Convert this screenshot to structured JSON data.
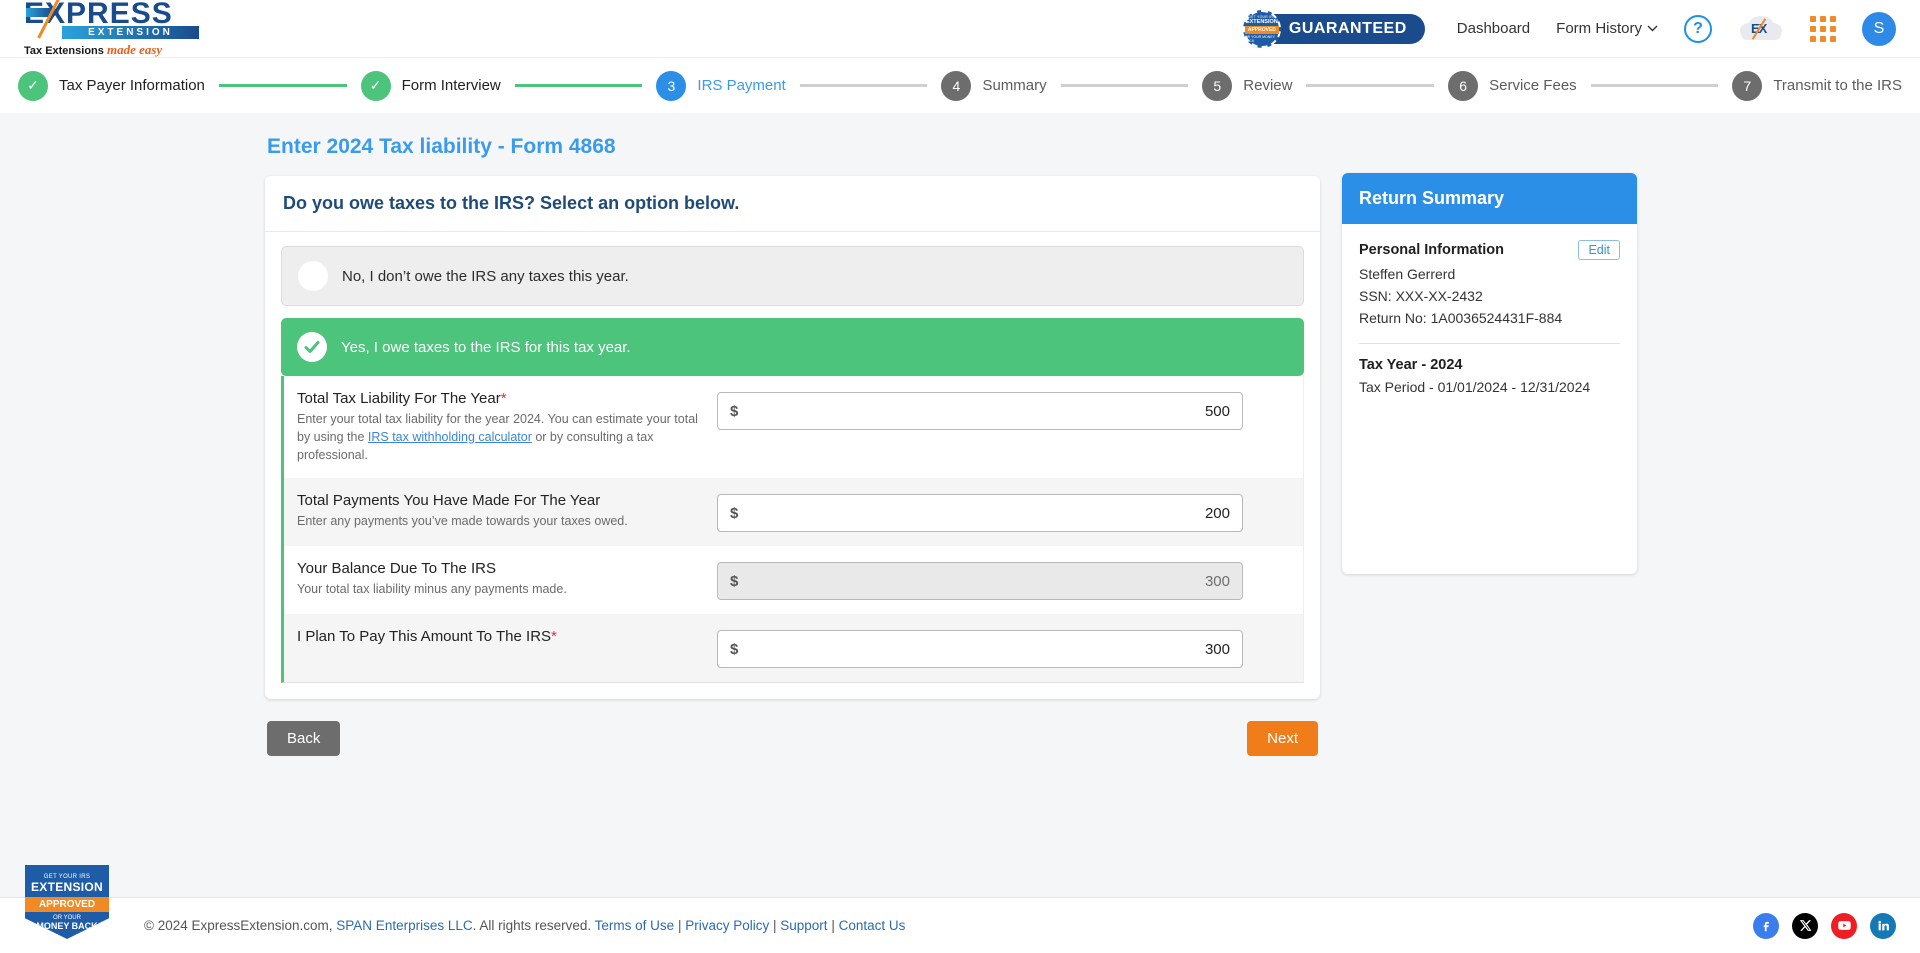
{
  "header": {
    "logo": {
      "express": "EXPRESS",
      "extension": "EXTENSION",
      "tagline_bold": "Tax Extensions",
      "tagline_italic": "made easy"
    },
    "guaranteed": {
      "label": "GUARANTEED",
      "seal_line1": "GET YOUR IRS",
      "seal_line2": "EXTENSION",
      "seal_line3": "APPROVED",
      "seal_line4": "OR YOUR MONEY BACK"
    },
    "nav": {
      "dashboard": "Dashboard",
      "form_history": "Form History",
      "chevron": "⌄"
    },
    "help_icon_label": "?",
    "cloud_icon_label": "EX",
    "avatar_initial": "S"
  },
  "stepper": {
    "steps": [
      {
        "number": "1",
        "label": "Tax Payer Information",
        "state": "done",
        "mark": "✓"
      },
      {
        "number": "2",
        "label": "Form Interview",
        "state": "done",
        "mark": "✓"
      },
      {
        "number": "3",
        "label": "IRS Payment",
        "state": "active",
        "mark": "3"
      },
      {
        "number": "4",
        "label": "Summary",
        "state": "todo",
        "mark": "4"
      },
      {
        "number": "5",
        "label": "Review",
        "state": "todo",
        "mark": "5"
      },
      {
        "number": "6",
        "label": "Service Fees",
        "state": "todo",
        "mark": "6"
      },
      {
        "number": "7",
        "label": "Transmit to the IRS",
        "state": "todo",
        "mark": "7"
      }
    ]
  },
  "main": {
    "page_title": "Enter 2024 Tax liability - Form 4868",
    "card_question": "Do you owe taxes to the IRS? Select an option below.",
    "options": [
      {
        "text": "No, I don’t owe the IRS any taxes this year.",
        "selected": false
      },
      {
        "text": "Yes, I owe taxes to the IRS for this tax year.",
        "selected": true
      }
    ],
    "fields": [
      {
        "label": "Total Tax Liability For The Year",
        "required": true,
        "desc_before": "Enter your total tax liability for the year 2024. You can estimate your total by using the ",
        "desc_link": "IRS tax withholding calculator",
        "desc_after": " or by consulting a tax professional.",
        "currency": "$",
        "value": "500",
        "disabled": false
      },
      {
        "label": "Total Payments You Have Made For The Year",
        "required": false,
        "desc_before": "Enter any payments you’ve made towards your taxes owed.",
        "desc_link": "",
        "desc_after": "",
        "currency": "$",
        "value": "200",
        "disabled": false
      },
      {
        "label": "Your Balance Due To The IRS",
        "required": false,
        "desc_before": "Your total tax liability minus any payments made.",
        "desc_link": "",
        "desc_after": "",
        "currency": "$",
        "value": "300",
        "disabled": true
      },
      {
        "label": "I Plan To Pay This Amount To The IRS",
        "required": true,
        "desc_before": "",
        "desc_link": "",
        "desc_after": "",
        "currency": "$",
        "value": "300",
        "disabled": false
      }
    ],
    "back_label": "Back",
    "next_label": "Next"
  },
  "summary": {
    "title": "Return Summary",
    "personal_title": "Personal Information",
    "edit_label": "Edit",
    "name": "Steffen Gerrerd",
    "ssn": "SSN: XXX-XX-2432",
    "return_no": "Return No: 1A0036524431F-884",
    "tax_year": "Tax Year - 2024",
    "tax_period": "Tax Period - 01/01/2024 - 12/31/2024"
  },
  "footer": {
    "copyright_pre": "© 2024 ExpressExtension.com, ",
    "company": "SPAN Enterprises LLC",
    "copyright_post": ". All rights reserved. ",
    "links": [
      "Terms of Use",
      "Privacy Policy",
      "Support",
      "Contact Us"
    ],
    "separator": " | ",
    "badge": {
      "line1": "GET YOUR IRS",
      "line2": "EXTENSION",
      "line3": "APPROVED",
      "line4": "OR YOUR",
      "line5": "MONEY BACK"
    }
  },
  "colors": {
    "accent_blue": "#2b8fe8",
    "success_green": "#4cc47c",
    "orange": "#f07d1a",
    "gray": "#6d6d6d"
  }
}
